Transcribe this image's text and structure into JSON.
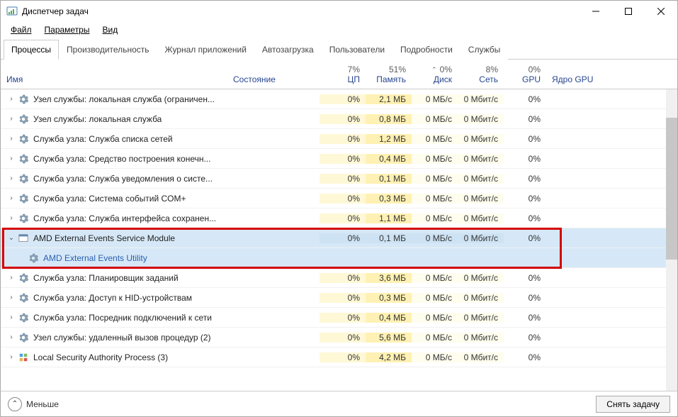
{
  "window": {
    "title": "Диспетчер задач"
  },
  "menu": {
    "file": "Файл",
    "options": "Параметры",
    "view": "Вид"
  },
  "tabs": [
    {
      "label": "Процессы",
      "active": true
    },
    {
      "label": "Производительность",
      "active": false
    },
    {
      "label": "Журнал приложений",
      "active": false
    },
    {
      "label": "Автозагрузка",
      "active": false
    },
    {
      "label": "Пользователи",
      "active": false
    },
    {
      "label": "Подробности",
      "active": false
    },
    {
      "label": "Службы",
      "active": false
    }
  ],
  "columns": {
    "name": "Имя",
    "status": "Состояние",
    "cpu": {
      "pct": "7%",
      "label": "ЦП"
    },
    "mem": {
      "pct": "51%",
      "label": "Память"
    },
    "disk": {
      "pct": "0%",
      "label": "Диск"
    },
    "net": {
      "pct": "8%",
      "label": "Сеть"
    },
    "gpu": {
      "pct": "0%",
      "label": "GPU"
    },
    "gpucore": "Ядро GPU"
  },
  "rows": [
    {
      "name": "Узел службы: локальная служба (ограничен...",
      "cpu": "0%",
      "mem": "2,1 МБ",
      "disk": "0 МБ/с",
      "net": "0 Мбит/с",
      "gpu": "0%",
      "kind": "group"
    },
    {
      "name": "Узел службы: локальная служба",
      "cpu": "0%",
      "mem": "0,8 МБ",
      "disk": "0 МБ/с",
      "net": "0 Мбит/с",
      "gpu": "0%",
      "kind": "group"
    },
    {
      "name": "Служба узла: Служба списка сетей",
      "cpu": "0%",
      "mem": "1,2 МБ",
      "disk": "0 МБ/с",
      "net": "0 Мбит/с",
      "gpu": "0%",
      "kind": "group"
    },
    {
      "name": "Служба узла: Средство построения конечн...",
      "cpu": "0%",
      "mem": "0,4 МБ",
      "disk": "0 МБ/с",
      "net": "0 Мбит/с",
      "gpu": "0%",
      "kind": "group"
    },
    {
      "name": "Служба узла: Служба уведомления о систе...",
      "cpu": "0%",
      "mem": "0,1 МБ",
      "disk": "0 МБ/с",
      "net": "0 Мбит/с",
      "gpu": "0%",
      "kind": "group"
    },
    {
      "name": "Служба узла: Система событий COM+",
      "cpu": "0%",
      "mem": "0,3 МБ",
      "disk": "0 МБ/с",
      "net": "0 Мбит/с",
      "gpu": "0%",
      "kind": "group"
    },
    {
      "name": "Служба узла: Служба интерфейса сохранен...",
      "cpu": "0%",
      "mem": "1,1 МБ",
      "disk": "0 МБ/с",
      "net": "0 Мбит/с",
      "gpu": "0%",
      "kind": "group"
    },
    {
      "name": "AMD External Events Service Module",
      "cpu": "0%",
      "mem": "0,1 МБ",
      "disk": "0 МБ/с",
      "net": "0 Мбит/с",
      "gpu": "0%",
      "kind": "selected",
      "expanded": true
    },
    {
      "name": "AMD External Events Utility",
      "kind": "child"
    },
    {
      "name": "Служба узла: Планировщик заданий",
      "cpu": "0%",
      "mem": "3,6 МБ",
      "disk": "0 МБ/с",
      "net": "0 Мбит/с",
      "gpu": "0%",
      "kind": "group"
    },
    {
      "name": "Служба узла: Доступ к HID-устройствам",
      "cpu": "0%",
      "mem": "0,3 МБ",
      "disk": "0 МБ/с",
      "net": "0 Мбит/с",
      "gpu": "0%",
      "kind": "group"
    },
    {
      "name": "Служба узла: Посредник подключений к сети",
      "cpu": "0%",
      "mem": "0,4 МБ",
      "disk": "0 МБ/с",
      "net": "0 Мбит/с",
      "gpu": "0%",
      "kind": "group"
    },
    {
      "name": "Узел службы: удаленный вызов процедур (2)",
      "cpu": "0%",
      "mem": "5,6 МБ",
      "disk": "0 МБ/с",
      "net": "0 Мбит/с",
      "gpu": "0%",
      "kind": "group"
    },
    {
      "name": "Local Security Authority Process (3)",
      "cpu": "0%",
      "mem": "4,2 МБ",
      "disk": "0 МБ/с",
      "net": "0 Мбит/с",
      "gpu": "0%",
      "kind": "group",
      "icon": "lsa"
    }
  ],
  "statusbar": {
    "fewer": "Меньше",
    "endtask": "Снять задачу"
  }
}
